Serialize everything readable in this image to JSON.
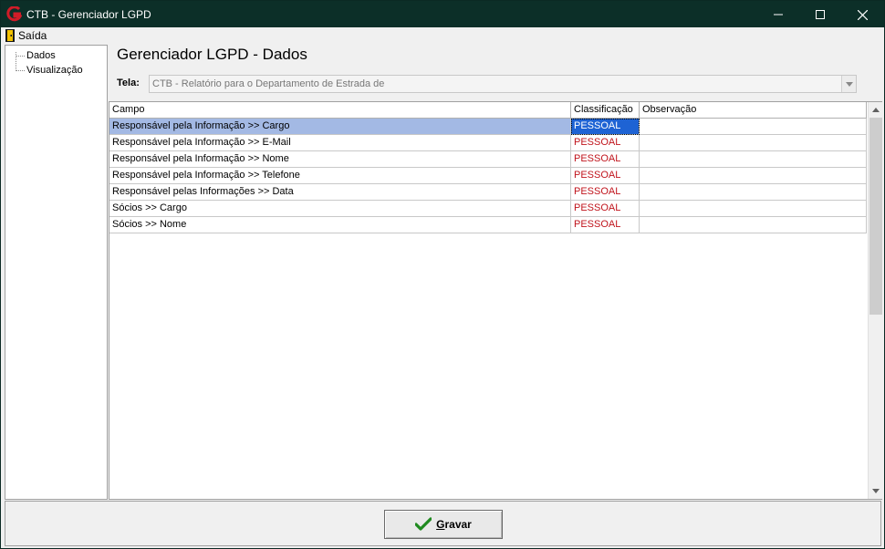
{
  "window": {
    "title": "CTB - Gerenciador LGPD",
    "minimize": "—",
    "maximize": "☐",
    "close": "✕"
  },
  "menu": {
    "exit_label": "Saída"
  },
  "tree": {
    "items": [
      {
        "label": "Dados"
      },
      {
        "label": "Visualização"
      }
    ]
  },
  "main": {
    "heading": "Gerenciador LGPD - Dados",
    "tela_label": "Tela:",
    "tela_value": "CTB - Relatório para o Departamento de Estrada de"
  },
  "grid": {
    "columns": [
      "Campo",
      "Classificação",
      "Observação"
    ],
    "rows": [
      {
        "campo": "Responsável pela Informação >> Cargo",
        "classificacao": "PESSOAL",
        "observacao": ""
      },
      {
        "campo": "Responsável pela Informação >> E-Mail",
        "classificacao": "PESSOAL",
        "observacao": ""
      },
      {
        "campo": "Responsável pela Informação >> Nome",
        "classificacao": "PESSOAL",
        "observacao": ""
      },
      {
        "campo": "Responsável pela Informação >> Telefone",
        "classificacao": "PESSOAL",
        "observacao": ""
      },
      {
        "campo": "Responsável pelas Informações >> Data",
        "classificacao": "PESSOAL",
        "observacao": ""
      },
      {
        "campo": "Sócios >> Cargo",
        "classificacao": "PESSOAL",
        "observacao": ""
      },
      {
        "campo": "Sócios >> Nome",
        "classificacao": "PESSOAL",
        "observacao": ""
      }
    ]
  },
  "footer": {
    "save_label": "Gravar"
  },
  "colors": {
    "titlebar": "#0c2f28",
    "selected_row": "#a3b9e4",
    "selected_cell": "#1e63d4",
    "classification_text": "#c0141c"
  },
  "icons": {
    "app": "app-logo-icon",
    "exit": "exit-door-icon",
    "save": "checkmark-icon"
  }
}
